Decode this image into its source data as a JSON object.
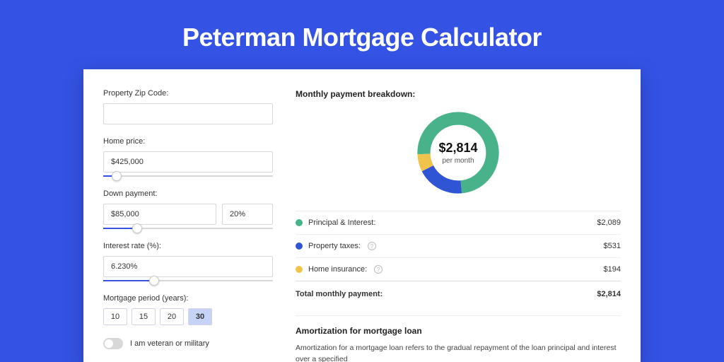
{
  "page_title": "Peterman Mortgage Calculator",
  "form": {
    "zip_label": "Property Zip Code:",
    "zip_value": "",
    "home_price_label": "Home price:",
    "home_price_value": "$425,000",
    "home_price_slider_pct": 8,
    "down_label": "Down payment:",
    "down_value": "$85,000",
    "down_pct_value": "20%",
    "down_slider_pct": 20,
    "rate_label": "Interest rate (%):",
    "rate_value": "6.230%",
    "rate_slider_pct": 30,
    "period_label": "Mortgage period (years):",
    "period_options": [
      "10",
      "15",
      "20",
      "30"
    ],
    "period_selected_index": 3,
    "veteran_label": "I am veteran or military"
  },
  "breakdown": {
    "title": "Monthly payment breakdown:",
    "center_amount": "$2,814",
    "center_sub": "per month",
    "items": [
      {
        "label": "Principal & Interest:",
        "value": "$2,089",
        "color": "green",
        "info": false,
        "numeric": 2089
      },
      {
        "label": "Property taxes:",
        "value": "$531",
        "color": "blue",
        "info": true,
        "numeric": 531
      },
      {
        "label": "Home insurance:",
        "value": "$194",
        "color": "yellow",
        "info": true,
        "numeric": 194
      }
    ],
    "total_label": "Total monthly payment:",
    "total_value": "$2,814"
  },
  "amort": {
    "title": "Amortization for mortgage loan",
    "text": "Amortization for a mortgage loan refers to the gradual repayment of the loan principal and interest over a specified"
  },
  "chart_data": {
    "type": "pie",
    "title": "Monthly payment breakdown",
    "series": [
      {
        "name": "Principal & Interest",
        "value": 2089,
        "color": "#48b28a"
      },
      {
        "name": "Property taxes",
        "value": 531,
        "color": "#2f55d4"
      },
      {
        "name": "Home insurance",
        "value": 194,
        "color": "#f0c44c"
      }
    ],
    "center_label": "$2,814 per month",
    "total": 2814
  }
}
